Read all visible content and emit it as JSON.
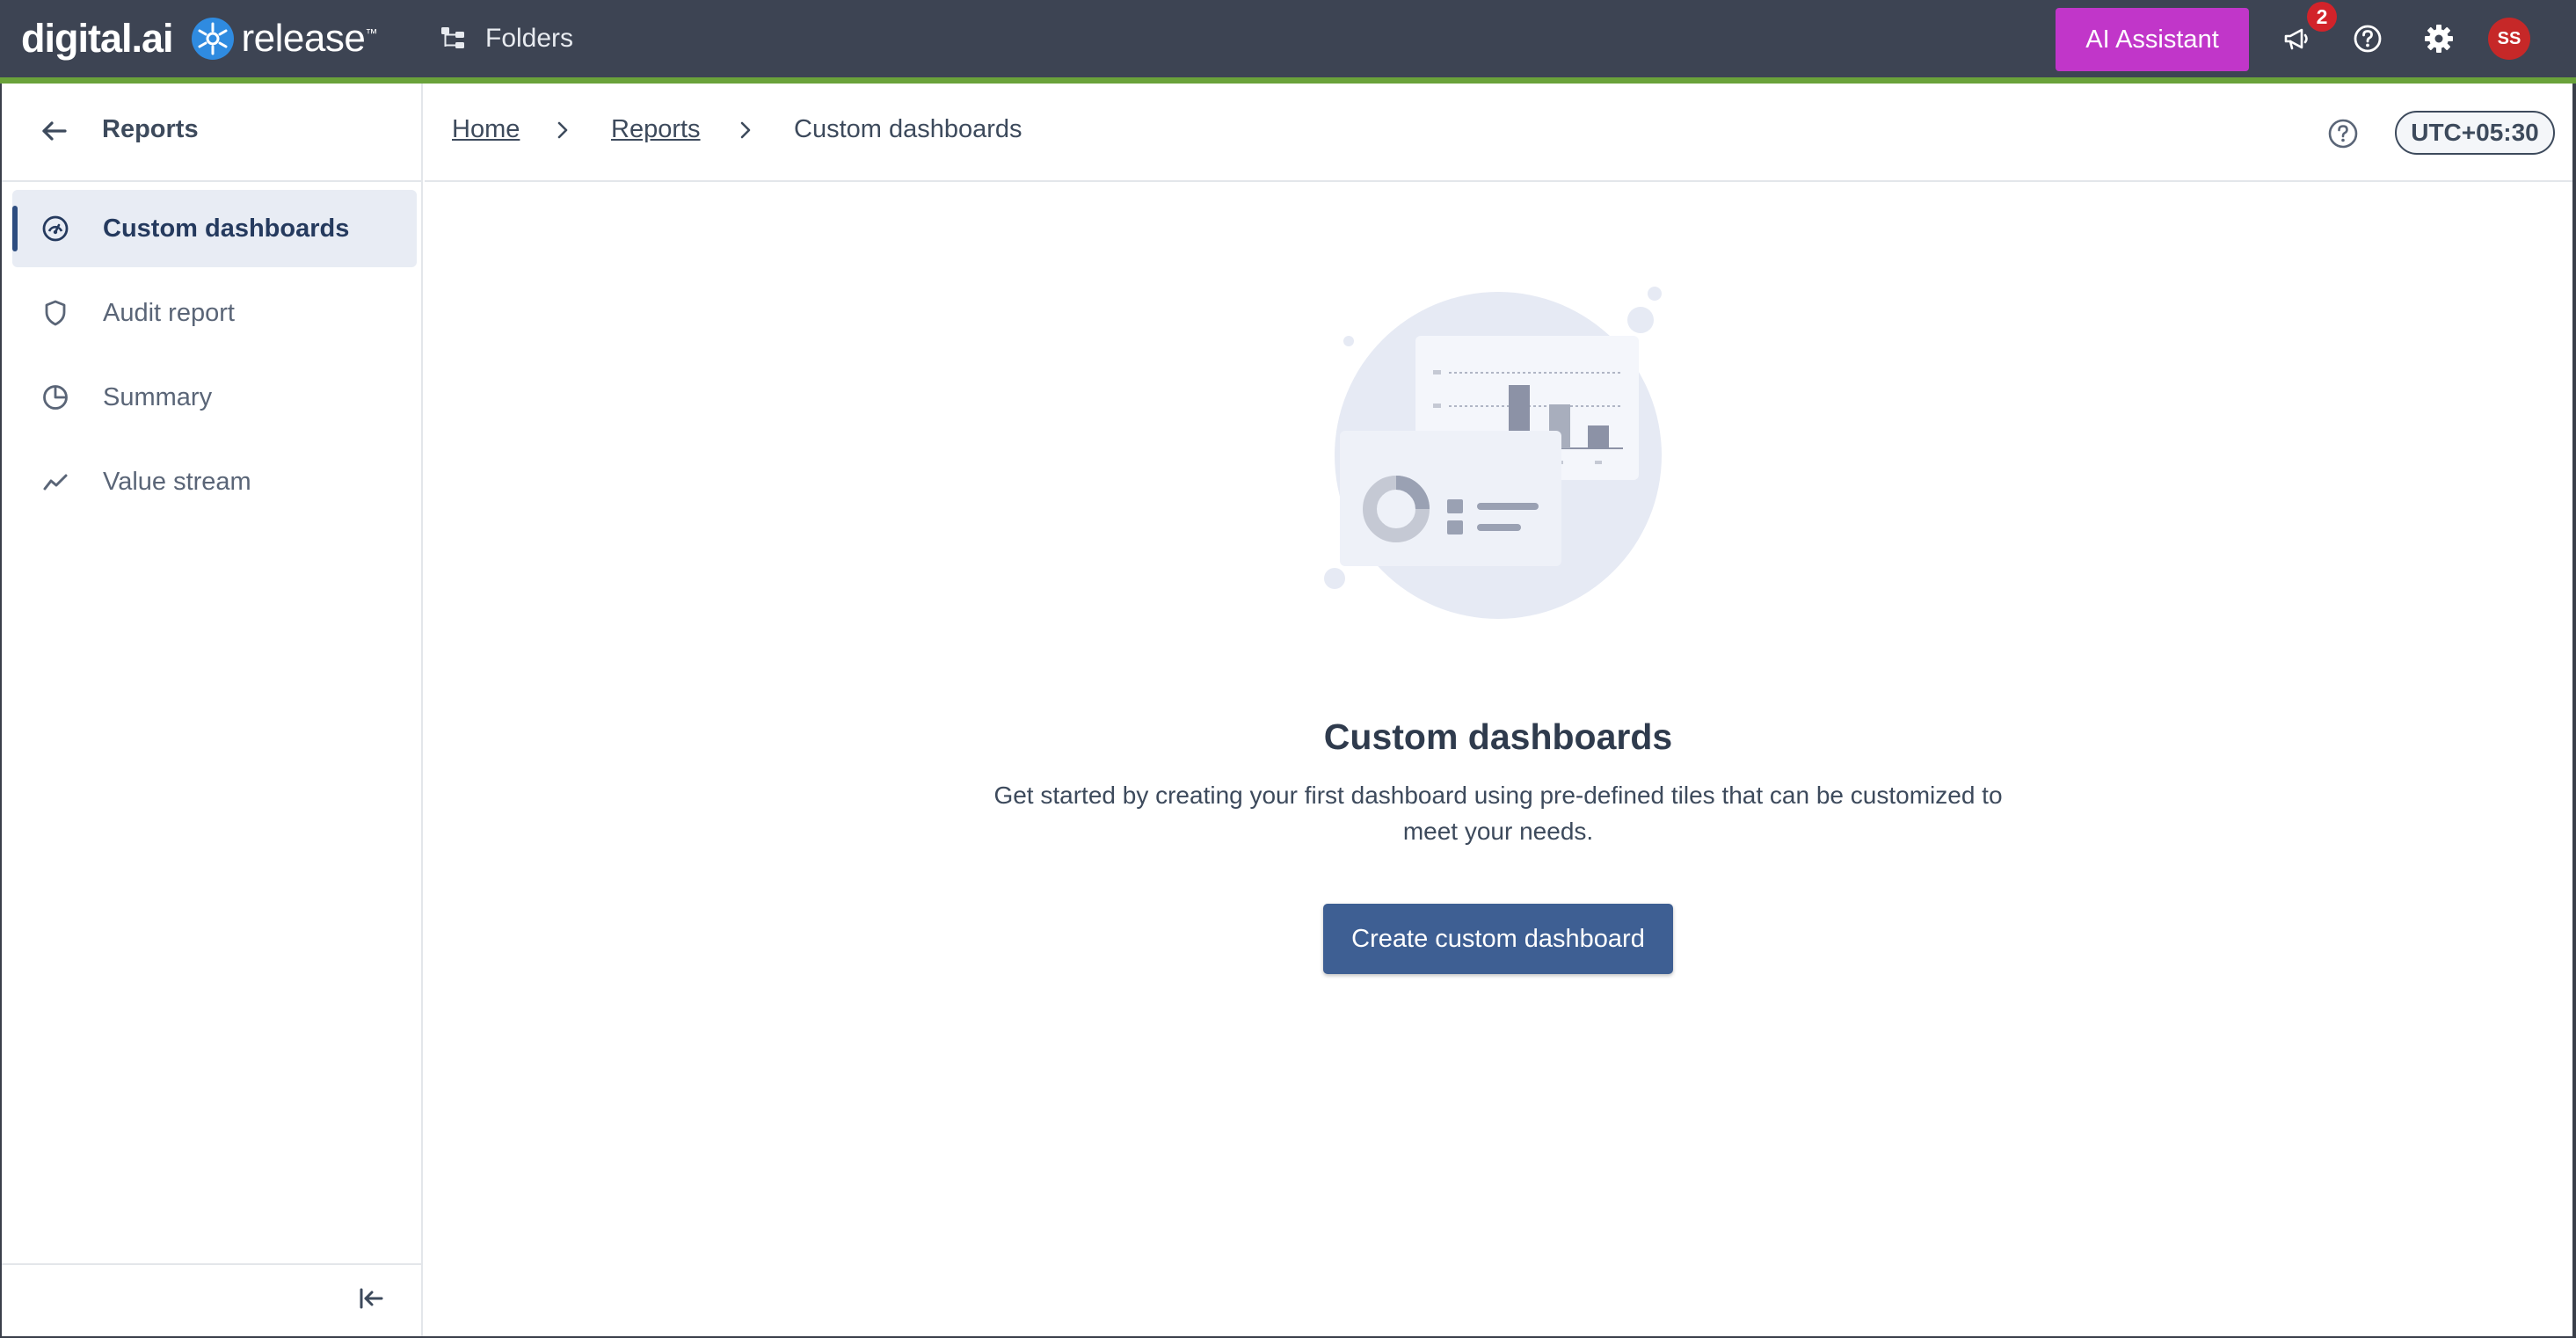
{
  "topbar": {
    "brand_digital": "digital.ai",
    "brand_release": "release",
    "brand_release_mark": "™",
    "folders_label": "Folders",
    "ai_assistant_label": "AI Assistant",
    "notification_count": "2",
    "avatar_initials": "SS",
    "icons": [
      "folders-icon",
      "megaphone-icon",
      "help-icon",
      "gear-icon"
    ],
    "accent_color": "#6aa23a",
    "ai_button_color": "#c136c9"
  },
  "sidebar": {
    "title": "Reports",
    "items": [
      {
        "label": "Custom dashboards",
        "icon": "gauge-icon",
        "active": true
      },
      {
        "label": "Audit report",
        "icon": "shield-icon",
        "active": false
      },
      {
        "label": "Summary",
        "icon": "pie-chart-icon",
        "active": false
      },
      {
        "label": "Value stream",
        "icon": "trend-line-icon",
        "active": false
      }
    ]
  },
  "breadcrumb": {
    "items": [
      {
        "label": "Home",
        "link": true
      },
      {
        "label": "Reports",
        "link": true
      },
      {
        "label": "Custom dashboards",
        "link": false
      }
    ],
    "timezone": "UTC+05:30"
  },
  "empty_state": {
    "title": "Custom dashboards",
    "description": "Get started by creating your first dashboard using pre-defined tiles that can be customized to meet your needs.",
    "button_label": "Create custom dashboard",
    "button_color": "#3e5f93"
  }
}
